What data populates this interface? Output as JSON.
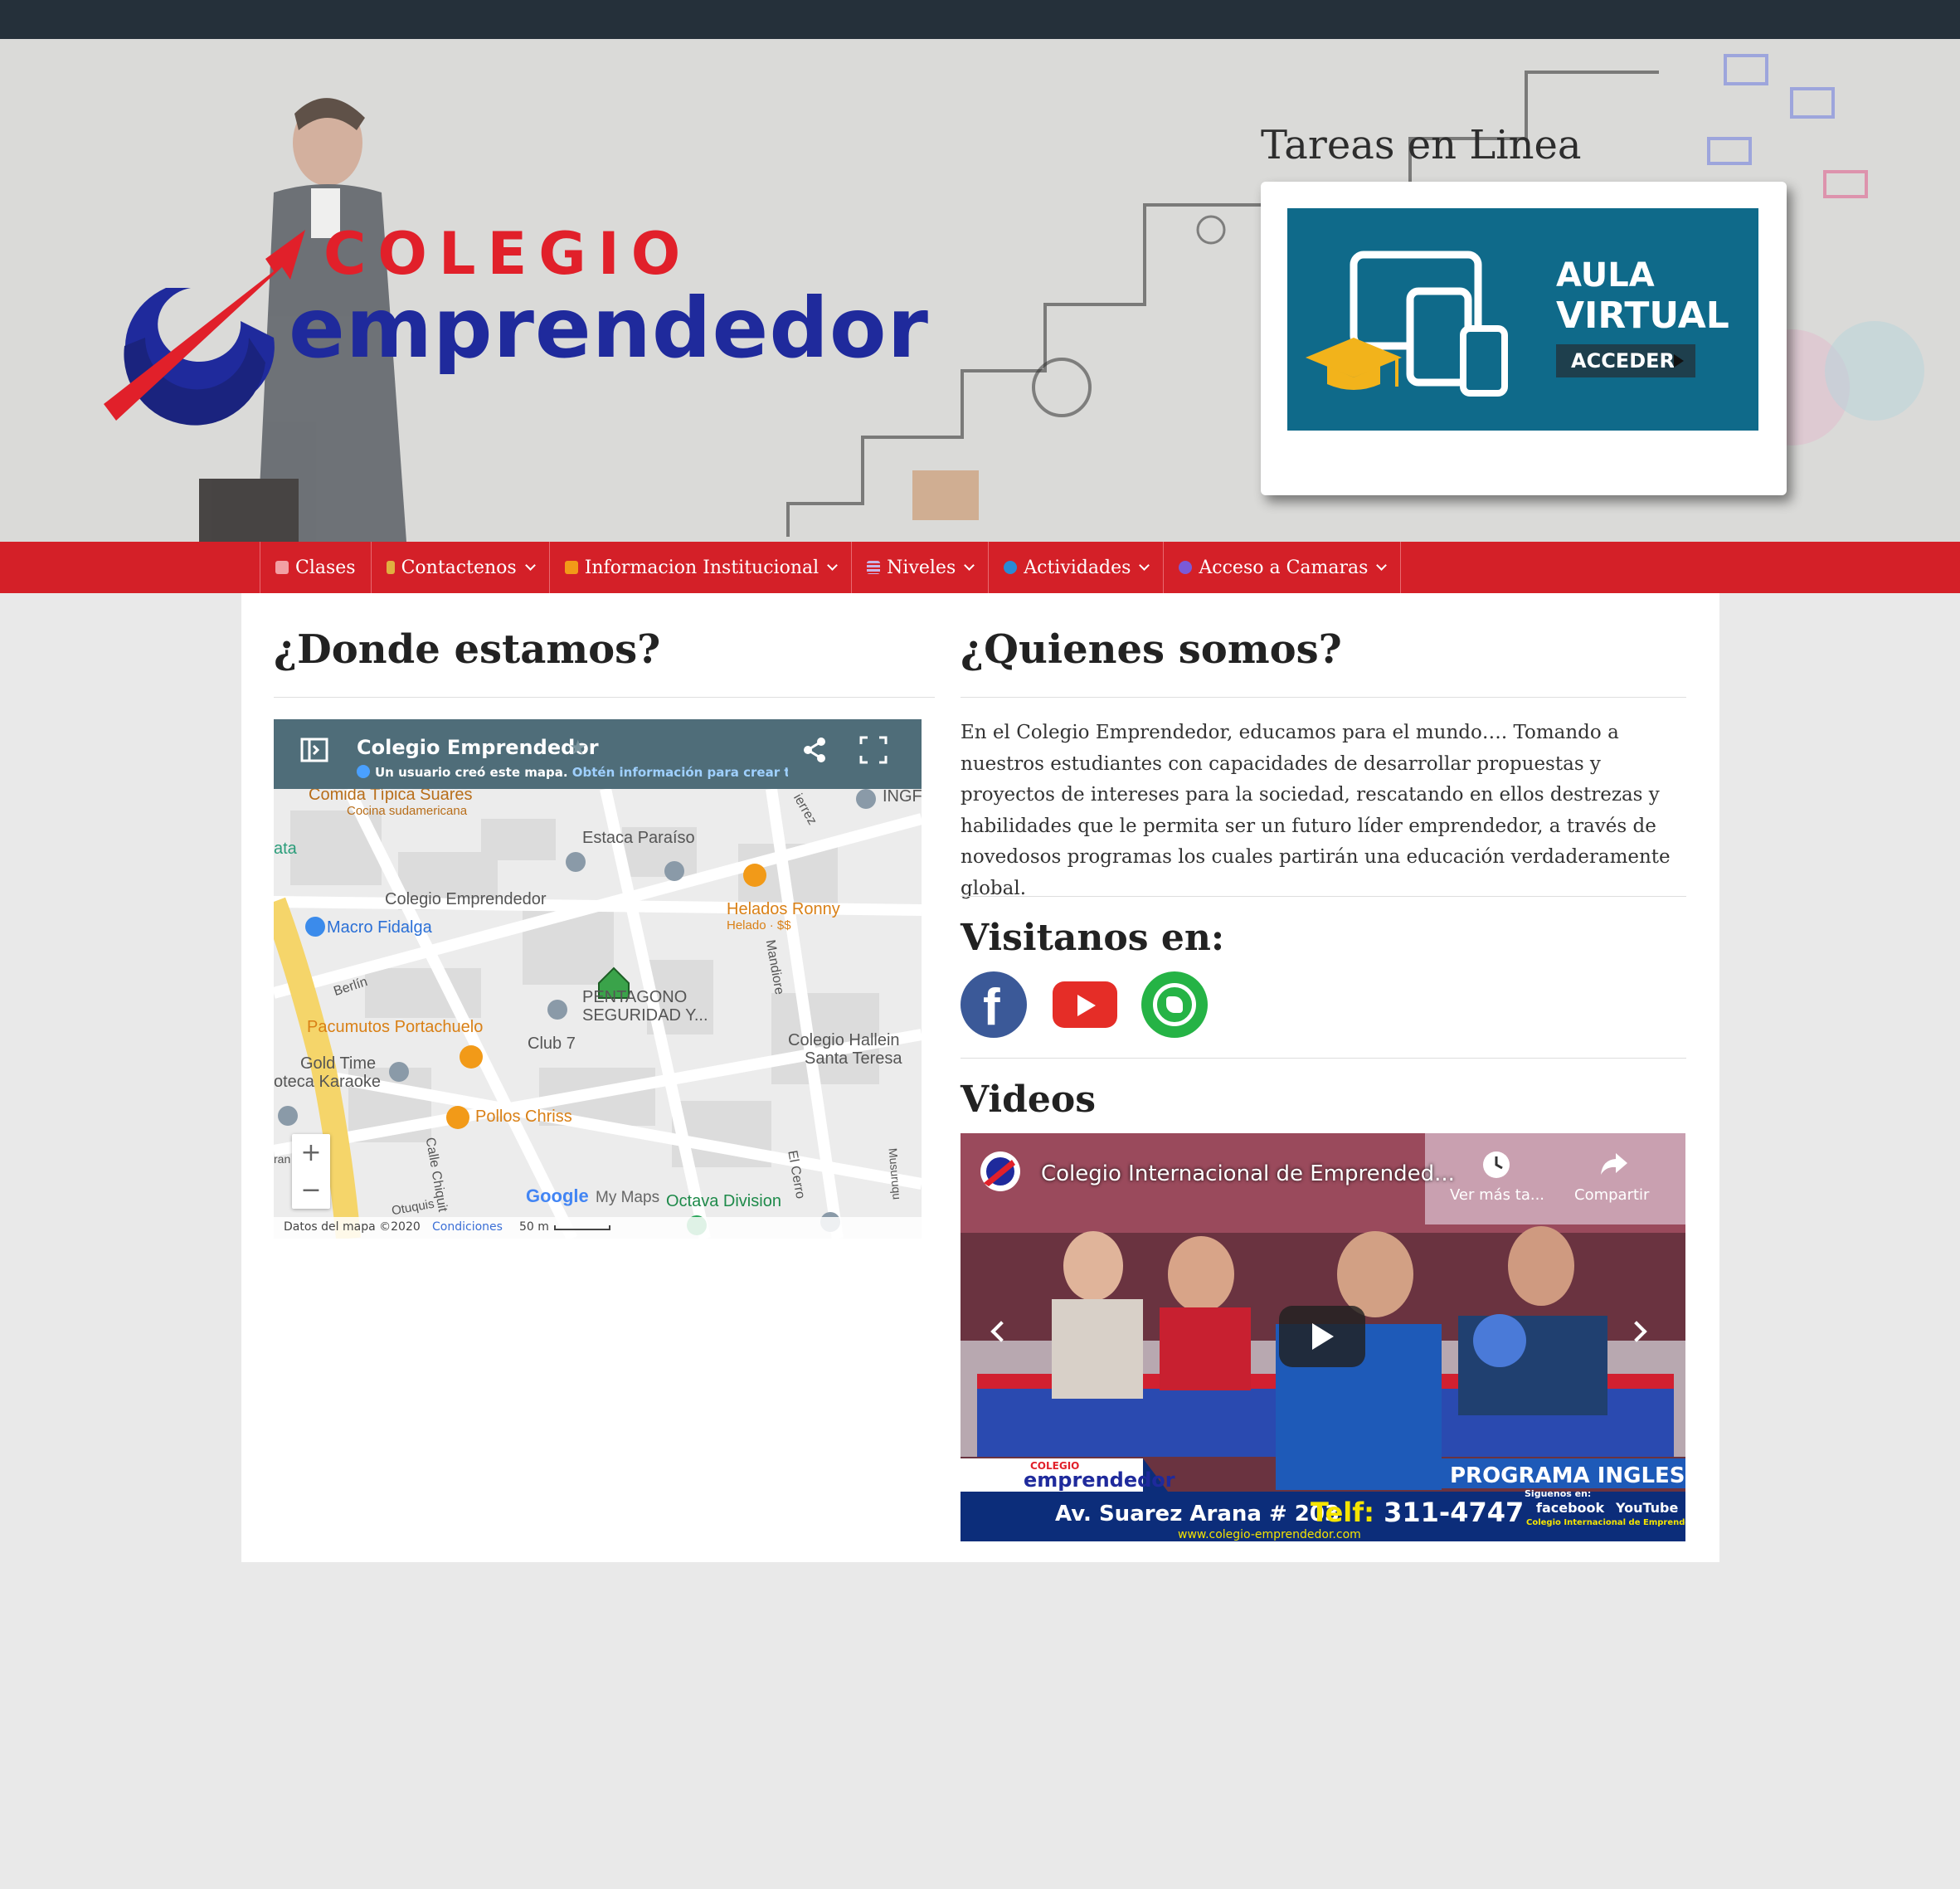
{
  "header": {
    "logo_line1": "COLEGIO",
    "logo_line2": "emprendedor",
    "tareas_title": "Tareas en Linea",
    "aula": {
      "line1": "AULA",
      "line2": "VIRTUAL",
      "button": "ACCEDER"
    }
  },
  "nav": {
    "items": [
      {
        "label": "Clases",
        "icon": "home-icon",
        "color": "#f2a0a4",
        "caret": false
      },
      {
        "label": "Contactenos",
        "icon": "person-icon",
        "color": "#e0b040",
        "caret": true
      },
      {
        "label": "Informacion Institucional",
        "icon": "folder-icon",
        "color": "#f29a18",
        "caret": true
      },
      {
        "label": "Niveles",
        "icon": "list-icon",
        "color": "#c9b5e6",
        "caret": true
      },
      {
        "label": "Actividades",
        "icon": "globe-icon",
        "color": "#2a8ad4",
        "caret": true
      },
      {
        "label": "Acceso a Camaras",
        "icon": "camera-icon",
        "color": "#7a5ad8",
        "caret": true
      }
    ]
  },
  "left": {
    "heading": "¿Donde estamos?",
    "map": {
      "title": "Colegio Emprendedor",
      "subtitle": "Un usuario creó este mapa.",
      "subtitle_link": "Obtén información para crear tu pro",
      "places": {
        "p1": "Comida Típica Suares",
        "p2": "Cocina sudamericana",
        "p3": "Estaca Paraíso",
        "p4": "ata",
        "p5": "Colegio Emprendedor",
        "p6": "Helados Ronny",
        "p7": "Helado · $$",
        "p8": "Macro Fidalga",
        "p9": "Berlín",
        "p10": "PENTAGONO",
        "p11": "SEGURIDAD Y...",
        "p12": "Mandiore",
        "p13": "Pacumutos Portachuelo",
        "p14": "Club 7",
        "p15": "Colegio Hallein",
        "p16": "Santa Teresa",
        "p17": "Gold Time",
        "p18": "oteca Karaoke",
        "p19": "Pollos Chriss",
        "p20": "Calle Chiquit",
        "p21": "El Cerro",
        "p22": "Musuruqu",
        "p23": "Otuquis",
        "p24": "Octava Division",
        "p25": "INGF",
        "p26": "ierrez",
        "p27": "ran"
      },
      "google": "Google",
      "mymaps": "My Maps",
      "footer_data": "Datos del mapa ©2020",
      "footer_terms": "Condiciones",
      "footer_scale": "50 m",
      "zoom_in": "+",
      "zoom_out": "−"
    }
  },
  "right": {
    "heading": "¿Quienes somos?",
    "about": "En el Colegio Emprendedor, educamos para el mundo…. Tomando a nuestros estudiantes con capacidades de desarrollar propuestas y proyectos de intereses para la sociedad, rescatando en ellos destrezas y habilidades que le permita ser un futuro líder emprendedor, a través de novedosos programas los cuales partirán una educación verdaderamente global.",
    "visit_heading": "Visitanos en:",
    "social": [
      {
        "icon": "facebook-icon",
        "color": "#3b5998"
      },
      {
        "icon": "youtube-icon",
        "color": "#e52d27"
      },
      {
        "icon": "whatsapp-icon",
        "color": "#25b345"
      }
    ],
    "videos_heading": "Videos",
    "video": {
      "title": "Colegio Internacional de Emprended...",
      "watch_later": "Ver más ta...",
      "share": "Compartir",
      "banner_logo_top": "COLEGIO",
      "banner_logo": "emprendedor",
      "banner_program": "PROGRAMA INGLES",
      "banner_address": "Av. Suarez Arana # 203",
      "banner_tel_label": "Telf:",
      "banner_tel": "311-4747",
      "banner_follow": "Siguenos en:",
      "banner_facebook": "facebook",
      "banner_youtube": "YouTube",
      "banner_channel": "Colegio Internacional de Emprendedores",
      "banner_url": "www.colegio-emprendedor.com"
    }
  }
}
